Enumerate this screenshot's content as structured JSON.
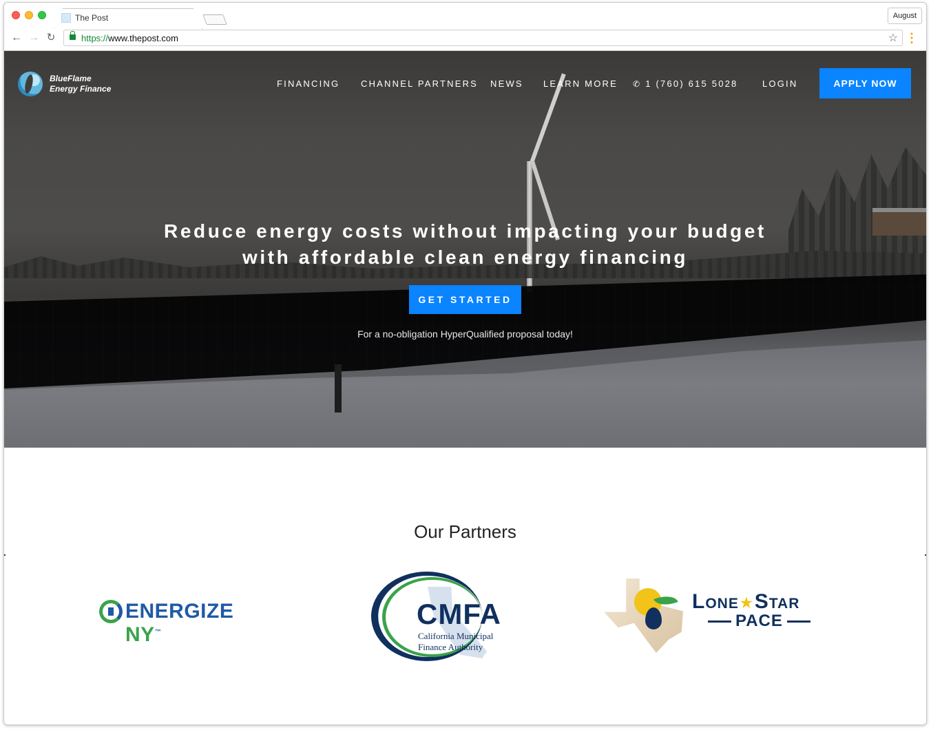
{
  "browser": {
    "tab_title": "The Post",
    "profile_label": "August",
    "url_scheme": "https://",
    "url_host": "www.thepost.com",
    "icons": [
      "back-icon",
      "forward-icon",
      "reload-icon",
      "lock-icon",
      "star-icon",
      "menu-dots-icon"
    ]
  },
  "site": {
    "logo_line1": "BlueFlame",
    "logo_line2": "Energy Finance",
    "nav": {
      "financing": "FINANCING",
      "channel_partners": "CHANNEL PARTNERS",
      "news": "NEWS",
      "learn_more": "LEARN MORE",
      "phone": "1 (760) 615 5028",
      "login": "LOGIN",
      "apply": "APPLY NOW"
    },
    "hero": {
      "title_line1": "Reduce energy costs without impacting your budget",
      "title_line2": "with affordable clean energy financing",
      "cta": "GET STARTED",
      "subtitle": "For a no-obligation HyperQualified proposal today!"
    },
    "partners": {
      "title": "Our Partners",
      "energize_main": "ENERGIZE",
      "energize_ny": " NY",
      "energize_tm": "™",
      "cmfa_main": "CMFA",
      "cmfa_sub1": "California Municipal",
      "cmfa_sub2": "Finance Authority",
      "lonestar_a": "Lone",
      "lonestar_star": "★",
      "lonestar_b": "Star",
      "lonestar_c": "PACE"
    }
  },
  "colors": {
    "accent_blue": "#0a84ff",
    "brand_navy": "#10305e",
    "brand_green": "#3aa34a",
    "brand_yellow": "#f2c318"
  }
}
